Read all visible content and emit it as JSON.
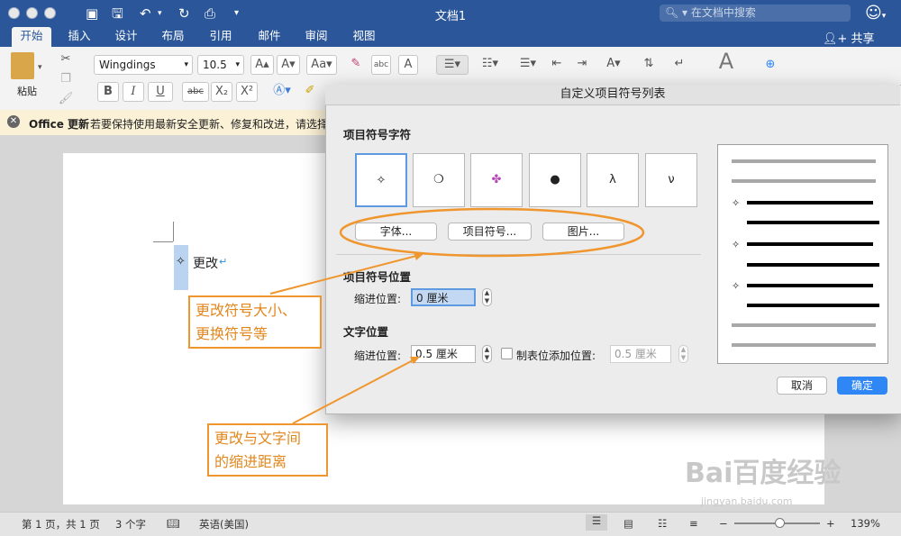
{
  "titlebar": {
    "doc_title": "文档1",
    "search_placeholder": "在文档中搜索",
    "share": "共享"
  },
  "tabs": [
    "开始",
    "插入",
    "设计",
    "布局",
    "引用",
    "邮件",
    "审阅",
    "视图"
  ],
  "ribbon": {
    "paste_label": "粘贴",
    "font_name": "Wingdings",
    "font_size": "10.5",
    "bold": "B",
    "italic": "I",
    "underline": "U",
    "strike": "abc",
    "subscript": "X₂",
    "superscript": "X²"
  },
  "update_bar": {
    "title": "Office 更新",
    "message": "若要保持使用最新安全更新、修复和改进，请选择"
  },
  "document": {
    "bullet": "✧",
    "text": "更改",
    "para_mark": "↵"
  },
  "dialog": {
    "title": "自定义项目符号列表",
    "section_chars": "项目符号字符",
    "bullet_chars": [
      "✧",
      "❍",
      "✤",
      "●",
      "λ",
      "ν"
    ],
    "btn_font": "字体...",
    "btn_bullet": "项目符号...",
    "btn_picture": "图片...",
    "section_bullet_pos": "项目符号位置",
    "indent_label_1": "缩进位置:",
    "indent_value_1": "0 厘米",
    "section_text_pos": "文字位置",
    "indent_label_2": "缩进位置:",
    "indent_value_2": "0.5 厘米",
    "tab_label": "制表位添加位置:",
    "tab_value": "0.5 厘米",
    "preview_bullet": "✧",
    "cancel": "取消",
    "ok": "确定"
  },
  "annotations": {
    "note1_line1": "更改符号大小、",
    "note1_line2": "更换符号等",
    "note2_line1": "更改与文字间",
    "note2_line2": "的缩进距离",
    "accent_color": "#f0962e"
  },
  "status": {
    "page": "第 1 页，共 1 页",
    "words": "3 个字",
    "language": "英语(美国)",
    "zoom": "139%"
  },
  "watermark": {
    "brand": "Bai百度经验",
    "url": "jingyan.baidu.com"
  }
}
